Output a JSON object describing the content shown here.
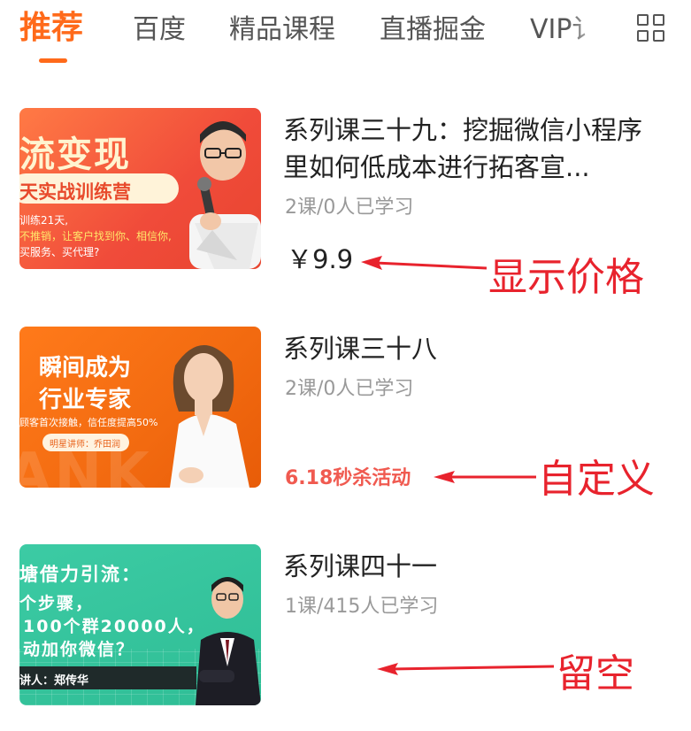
{
  "tabs": [
    {
      "label": "推荐",
      "active": true
    },
    {
      "label": "百度"
    },
    {
      "label": "精品课程"
    },
    {
      "label": "直播掘金"
    },
    {
      "label": "VIP讠"
    }
  ],
  "courses": [
    {
      "title": "系列课三十九：挖掘微信小程序里如何低成本进行拓客宣...",
      "meta": "2课/0人已学习",
      "price": "￥9.9",
      "thumb": {
        "line1": "流变现",
        "line2": "天实战训练营",
        "line3": "训练21天,",
        "line4": "不推销，让客户找到你、相信你,",
        "line5": "买服务、买代理?"
      }
    },
    {
      "title": "系列课三十八",
      "meta": "2课/0人已学习",
      "promo": "6.18秒杀活动",
      "thumb": {
        "line1": "瞬间成为",
        "line2": "行业专家",
        "line3": "顾客首次接触，信任度提高50%",
        "line4": "明星讲师：乔田润",
        "bg": "ANK"
      }
    },
    {
      "title": "系列课四十一",
      "meta": "1课/415人已学习",
      "thumb": {
        "line1": "塘借力引流：",
        "line2": "个步骤，",
        "line3": "100个群20000人，",
        "line4": "动加你微信？",
        "line5": "讲人：郑传华"
      }
    }
  ],
  "annotations": {
    "price": "显示价格",
    "custom": "自定义",
    "empty": "留空"
  },
  "colors": {
    "accent": "#ff6a1a",
    "promo": "#f05a50",
    "annotation": "#e8232d"
  },
  "icons": [
    "grid-menu-icon",
    "arrow-left-icon"
  ]
}
